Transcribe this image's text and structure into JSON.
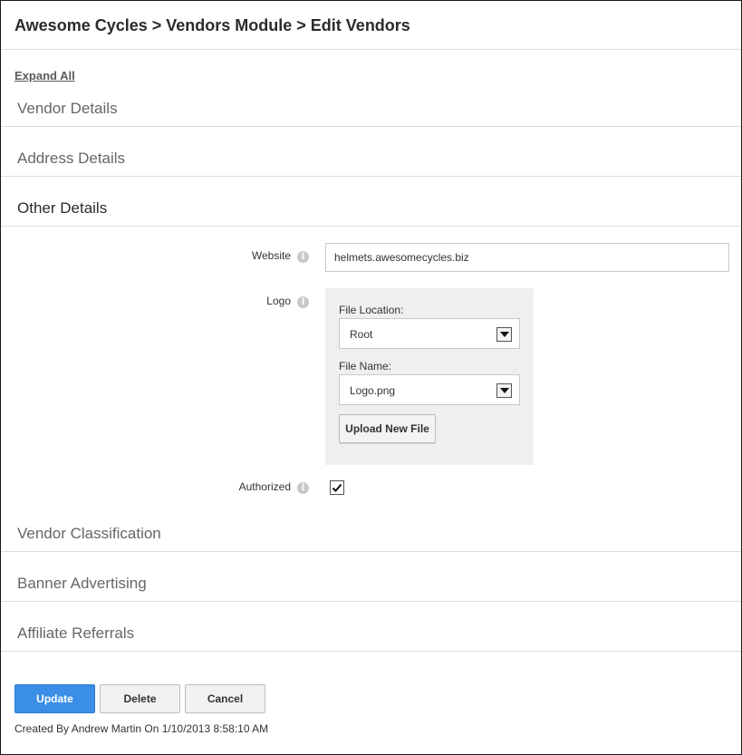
{
  "header": {
    "title": "Awesome Cycles > Vendors Module > Edit Vendors"
  },
  "expand_all": "Expand All",
  "sections": {
    "vendor_details": "Vendor Details",
    "address_details": "Address Details",
    "other_details": "Other Details",
    "vendor_classification": "Vendor Classification",
    "banner_advertising": "Banner Advertising",
    "affiliate_referrals": "Affiliate Referrals"
  },
  "other_details": {
    "website": {
      "label": "Website",
      "value": "helmets.awesomecycles.biz",
      "info_icon": "info-icon"
    },
    "logo": {
      "label": "Logo",
      "info_icon": "info-icon",
      "file_location_label": "File Location:",
      "file_location_value": "Root",
      "file_name_label": "File Name:",
      "file_name_value": "Logo.png",
      "upload_button": "Upload New File"
    },
    "authorized": {
      "label": "Authorized",
      "checked": true,
      "info_icon": "info-icon"
    }
  },
  "actions": {
    "update": "Update",
    "delete": "Delete",
    "cancel": "Cancel"
  },
  "footer": {
    "created_by": "Created By Andrew Martin On 1/10/2013 8:58:10 AM"
  },
  "colors": {
    "primary_button": "#3a8ee6",
    "divider": "#dcdcdc",
    "logo_panel_bg": "#efefef"
  }
}
